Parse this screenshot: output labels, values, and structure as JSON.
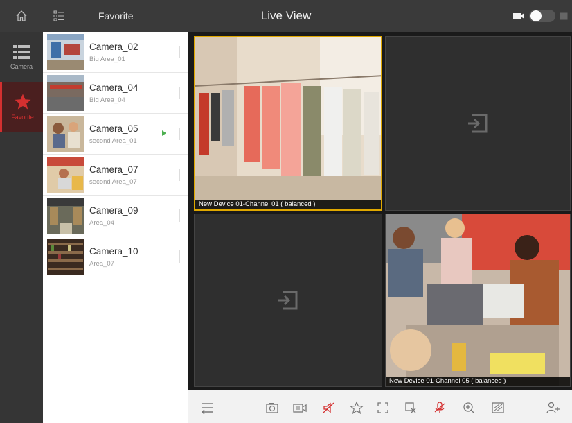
{
  "header": {
    "favorite_label": "Favorite",
    "title": "Live View"
  },
  "sidenav": {
    "items": [
      {
        "label": "Camera",
        "icon": "camera-list-icon",
        "active": false
      },
      {
        "label": "Favorite",
        "icon": "star-icon",
        "active": true
      }
    ]
  },
  "cameras": [
    {
      "name": "Camera_02",
      "area": "Big Area_01",
      "playing": false
    },
    {
      "name": "Camera_04",
      "area": "Big Area_04",
      "playing": false
    },
    {
      "name": "Camera_05",
      "area": "second Area_01",
      "playing": true
    },
    {
      "name": "Camera_07",
      "area": "second Area_07",
      "playing": false
    },
    {
      "name": "Camera_09",
      "area": "Area_04",
      "playing": false
    },
    {
      "name": "Camera_10",
      "area": "Area_07",
      "playing": false
    }
  ],
  "tiles": [
    {
      "label": "New Device 01-Channel 01 ( balanced )",
      "state": "playing",
      "selected": true
    },
    {
      "label": "",
      "state": "empty",
      "selected": false
    },
    {
      "label": "",
      "state": "empty",
      "selected": false
    },
    {
      "label": "New Device 01-Channel 05 ( balanced )",
      "state": "playing",
      "selected": false
    }
  ],
  "toolbar": [
    "menu-icon",
    "snapshot-icon",
    "record-icon",
    "audio-mute-icon",
    "favorite-star-icon",
    "fullscreen-icon",
    "stop-all-icon",
    "mic-icon",
    "zoom-icon",
    "image-settings-icon",
    "ptz-icon"
  ],
  "colors": {
    "accent_red": "#d43030",
    "selected_border": "#e0a800",
    "play_green": "#4caf50"
  }
}
